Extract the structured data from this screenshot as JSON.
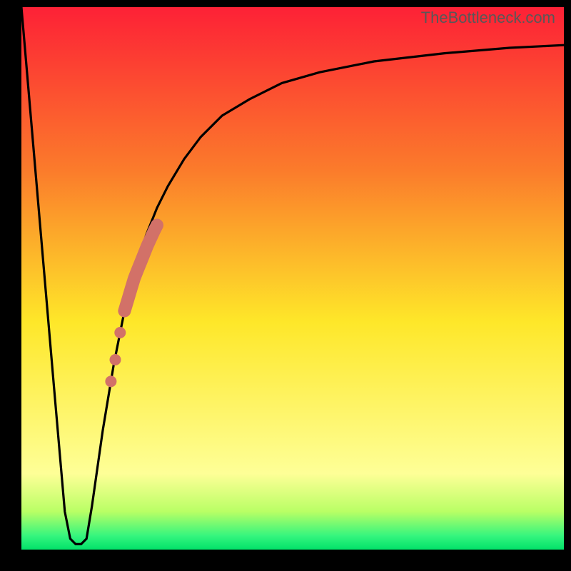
{
  "watermark": "TheBottleneck.com",
  "gradient": {
    "top": "#fd2136",
    "q1": "#fb7b2b",
    "mid": "#fee729",
    "q3_a": "#feff97",
    "q3_b": "#b9ff65",
    "bottom_edge": "#34f57e",
    "bottom": "#02e269"
  },
  "curve_color": "#000000",
  "marker_color": "#d27168",
  "chart_data": {
    "type": "line",
    "title": "",
    "xlabel": "",
    "ylabel": "",
    "xlim": [
      0,
      100
    ],
    "ylim": [
      0,
      100
    ],
    "grid": false,
    "legend": false,
    "annotations": [],
    "series": [
      {
        "name": "curve",
        "x": [
          0,
          6,
          8,
          9,
          10,
          11,
          12,
          13,
          14,
          15,
          16,
          17,
          18,
          19,
          20,
          21,
          23,
          25,
          27,
          30,
          33,
          37,
          42,
          48,
          55,
          65,
          78,
          90,
          100
        ],
        "y": [
          100,
          30,
          7,
          2,
          1,
          1,
          2,
          8,
          15,
          22,
          28,
          34,
          39,
          44,
          48,
          52,
          58,
          63,
          67,
          72,
          76,
          80,
          83,
          86,
          88,
          90,
          91.5,
          92.5,
          93
        ]
      }
    ],
    "markers": [
      {
        "name": "highlight-segment",
        "x": [
          19,
          19.6,
          20.2,
          20.8,
          21.4,
          22.0,
          22.6,
          23.2,
          23.8,
          24.4,
          25.0
        ],
        "y": [
          44,
          46,
          48,
          50,
          51.5,
          53,
          54.5,
          56,
          57.3,
          58.6,
          59.8
        ]
      },
      {
        "name": "lower-dots",
        "x": [
          16.5,
          17.3,
          18.2
        ],
        "y": [
          31,
          35,
          40
        ]
      }
    ]
  }
}
